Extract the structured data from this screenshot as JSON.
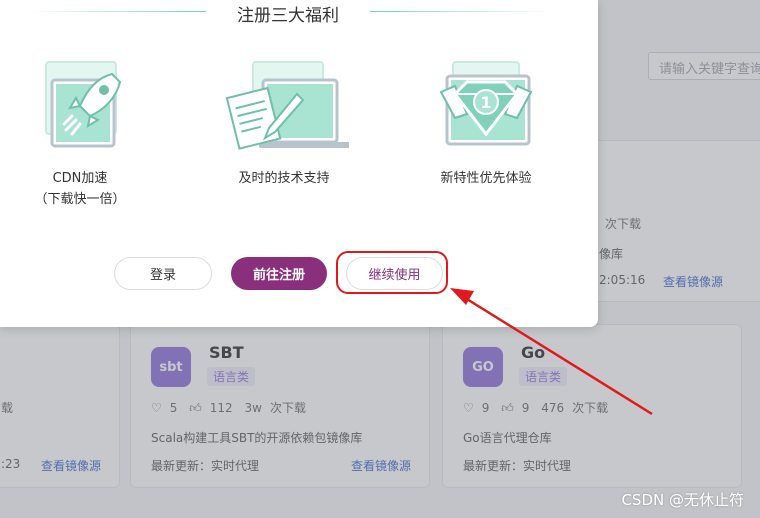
{
  "background": {
    "search_placeholder": "请输入关键字查询",
    "top_right_card": {
      "downloads_label": "次下载",
      "desc_fragment": "像库",
      "time_fragment": "2:05:16",
      "link": "查看镜像源"
    },
    "left_card": {
      "downloads_fragment": "载",
      "time_fragment": ":23",
      "link": "查看镜像源"
    },
    "sbt_card": {
      "logo": "sbt",
      "title": "SBT",
      "tag": "语言类",
      "likes": "5",
      "thumbs": "112",
      "downloads": "3w",
      "downloads_label": "次下载",
      "desc": "Scala构建工具SBT的开源依赖包镜像库",
      "updated": "最新更新：实时代理",
      "link": "查看镜像源"
    },
    "go_card": {
      "logo": "GO",
      "title": "Go",
      "tag": "语言类",
      "likes": "9",
      "thumbs": "9",
      "downloads": "476",
      "downloads_label": "次下载",
      "desc": "Go语言代理仓库",
      "updated": "最新更新：实时代理"
    }
  },
  "modal": {
    "title": "注册三大福利",
    "benefits": [
      {
        "label": "CDN加速",
        "sub": "（下载快一倍）",
        "icon": "rocket-icon"
      },
      {
        "label": "及时的技术支持",
        "sub": "",
        "icon": "document-pen-icon"
      },
      {
        "label": "新特性优先体验",
        "sub": "",
        "icon": "diamond-icon"
      }
    ],
    "buttons": {
      "login": "登录",
      "register": "前往注册",
      "continue": "继续使用"
    }
  },
  "colors": {
    "accent": "#8a2f7c",
    "highlight": "#e0191d",
    "teal": "#6fd3bf"
  },
  "watermark": "CSDN @无休止符"
}
